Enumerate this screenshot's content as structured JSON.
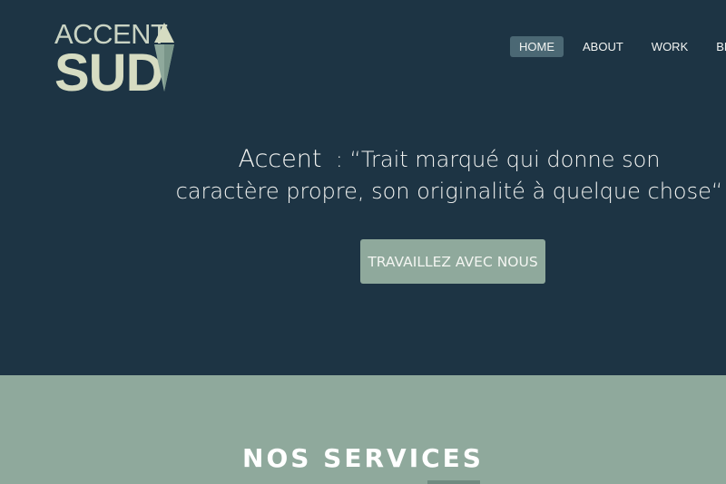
{
  "logo": {
    "top_text": "ACCENT",
    "bottom_text": "SUD"
  },
  "nav": {
    "items": [
      {
        "label": "HOME",
        "active": true
      },
      {
        "label": "ABOUT",
        "active": false
      },
      {
        "label": "WORK",
        "active": false
      },
      {
        "label": "BLOG",
        "active": false
      }
    ]
  },
  "hero": {
    "quote_word": "Accent",
    "quote_line1": "  : “Trait marqué qui donne son",
    "quote_line2": "caractère propre, son originalité à quelque chose“",
    "cta_label": "TRAVAILLEZ AVEC NOUS"
  },
  "services": {
    "title": "NOS SERVICES"
  },
  "colors": {
    "hero_bg": "#1d3444",
    "accent": "#8fa99c",
    "nav_active": "#4b6874",
    "logo": "#d6dcc2"
  }
}
